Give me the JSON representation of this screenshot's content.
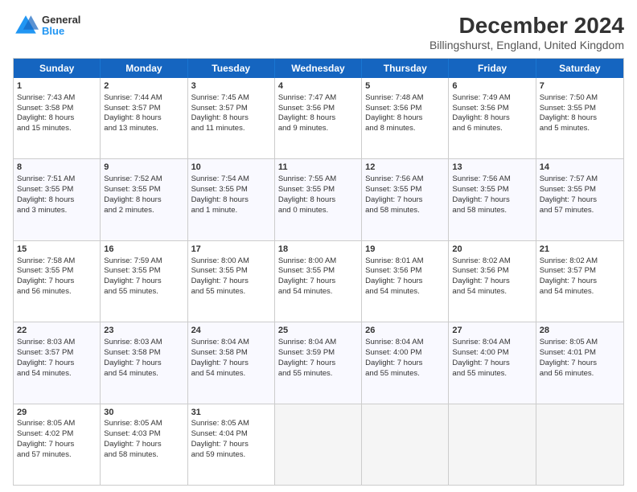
{
  "logo": {
    "general": "General",
    "blue": "Blue"
  },
  "title": "December 2024",
  "subtitle": "Billingshurst, England, United Kingdom",
  "days": [
    "Sunday",
    "Monday",
    "Tuesday",
    "Wednesday",
    "Thursday",
    "Friday",
    "Saturday"
  ],
  "weeks": [
    [
      {
        "day": "1",
        "rise": "7:43 AM",
        "set": "3:58 PM",
        "daylight": "8 hours and 15 minutes."
      },
      {
        "day": "2",
        "rise": "7:44 AM",
        "set": "3:57 PM",
        "daylight": "8 hours and 13 minutes."
      },
      {
        "day": "3",
        "rise": "7:45 AM",
        "set": "3:57 PM",
        "daylight": "8 hours and 11 minutes."
      },
      {
        "day": "4",
        "rise": "7:47 AM",
        "set": "3:56 PM",
        "daylight": "8 hours and 9 minutes."
      },
      {
        "day": "5",
        "rise": "7:48 AM",
        "set": "3:56 PM",
        "daylight": "8 hours and 8 minutes."
      },
      {
        "day": "6",
        "rise": "7:49 AM",
        "set": "3:56 PM",
        "daylight": "8 hours and 6 minutes."
      },
      {
        "day": "7",
        "rise": "7:50 AM",
        "set": "3:55 PM",
        "daylight": "8 hours and 5 minutes."
      }
    ],
    [
      {
        "day": "8",
        "rise": "7:51 AM",
        "set": "3:55 PM",
        "daylight": "8 hours and 3 minutes."
      },
      {
        "day": "9",
        "rise": "7:52 AM",
        "set": "3:55 PM",
        "daylight": "8 hours and 2 minutes."
      },
      {
        "day": "10",
        "rise": "7:54 AM",
        "set": "3:55 PM",
        "daylight": "8 hours and 1 minute."
      },
      {
        "day": "11",
        "rise": "7:55 AM",
        "set": "3:55 PM",
        "daylight": "8 hours and 0 minutes."
      },
      {
        "day": "12",
        "rise": "7:56 AM",
        "set": "3:55 PM",
        "daylight": "7 hours and 58 minutes."
      },
      {
        "day": "13",
        "rise": "7:56 AM",
        "set": "3:55 PM",
        "daylight": "7 hours and 58 minutes."
      },
      {
        "day": "14",
        "rise": "7:57 AM",
        "set": "3:55 PM",
        "daylight": "7 hours and 57 minutes."
      }
    ],
    [
      {
        "day": "15",
        "rise": "7:58 AM",
        "set": "3:55 PM",
        "daylight": "7 hours and 56 minutes."
      },
      {
        "day": "16",
        "rise": "7:59 AM",
        "set": "3:55 PM",
        "daylight": "7 hours and 55 minutes."
      },
      {
        "day": "17",
        "rise": "8:00 AM",
        "set": "3:55 PM",
        "daylight": "7 hours and 55 minutes."
      },
      {
        "day": "18",
        "rise": "8:00 AM",
        "set": "3:55 PM",
        "daylight": "7 hours and 54 minutes."
      },
      {
        "day": "19",
        "rise": "8:01 AM",
        "set": "3:56 PM",
        "daylight": "7 hours and 54 minutes."
      },
      {
        "day": "20",
        "rise": "8:02 AM",
        "set": "3:56 PM",
        "daylight": "7 hours and 54 minutes."
      },
      {
        "day": "21",
        "rise": "8:02 AM",
        "set": "3:57 PM",
        "daylight": "7 hours and 54 minutes."
      }
    ],
    [
      {
        "day": "22",
        "rise": "8:03 AM",
        "set": "3:57 PM",
        "daylight": "7 hours and 54 minutes."
      },
      {
        "day": "23",
        "rise": "8:03 AM",
        "set": "3:58 PM",
        "daylight": "7 hours and 54 minutes."
      },
      {
        "day": "24",
        "rise": "8:04 AM",
        "set": "3:58 PM",
        "daylight": "7 hours and 54 minutes."
      },
      {
        "day": "25",
        "rise": "8:04 AM",
        "set": "3:59 PM",
        "daylight": "7 hours and 55 minutes."
      },
      {
        "day": "26",
        "rise": "8:04 AM",
        "set": "4:00 PM",
        "daylight": "7 hours and 55 minutes."
      },
      {
        "day": "27",
        "rise": "8:04 AM",
        "set": "4:00 PM",
        "daylight": "7 hours and 55 minutes."
      },
      {
        "day": "28",
        "rise": "8:05 AM",
        "set": "4:01 PM",
        "daylight": "7 hours and 56 minutes."
      }
    ],
    [
      {
        "day": "29",
        "rise": "8:05 AM",
        "set": "4:02 PM",
        "daylight": "7 hours and 57 minutes."
      },
      {
        "day": "30",
        "rise": "8:05 AM",
        "set": "4:03 PM",
        "daylight": "7 hours and 58 minutes."
      },
      {
        "day": "31",
        "rise": "8:05 AM",
        "set": "4:04 PM",
        "daylight": "7 hours and 59 minutes."
      },
      null,
      null,
      null,
      null
    ]
  ],
  "labels": {
    "sunrise": "Sunrise:",
    "sunset": "Sunset:",
    "daylight": "Daylight:"
  }
}
